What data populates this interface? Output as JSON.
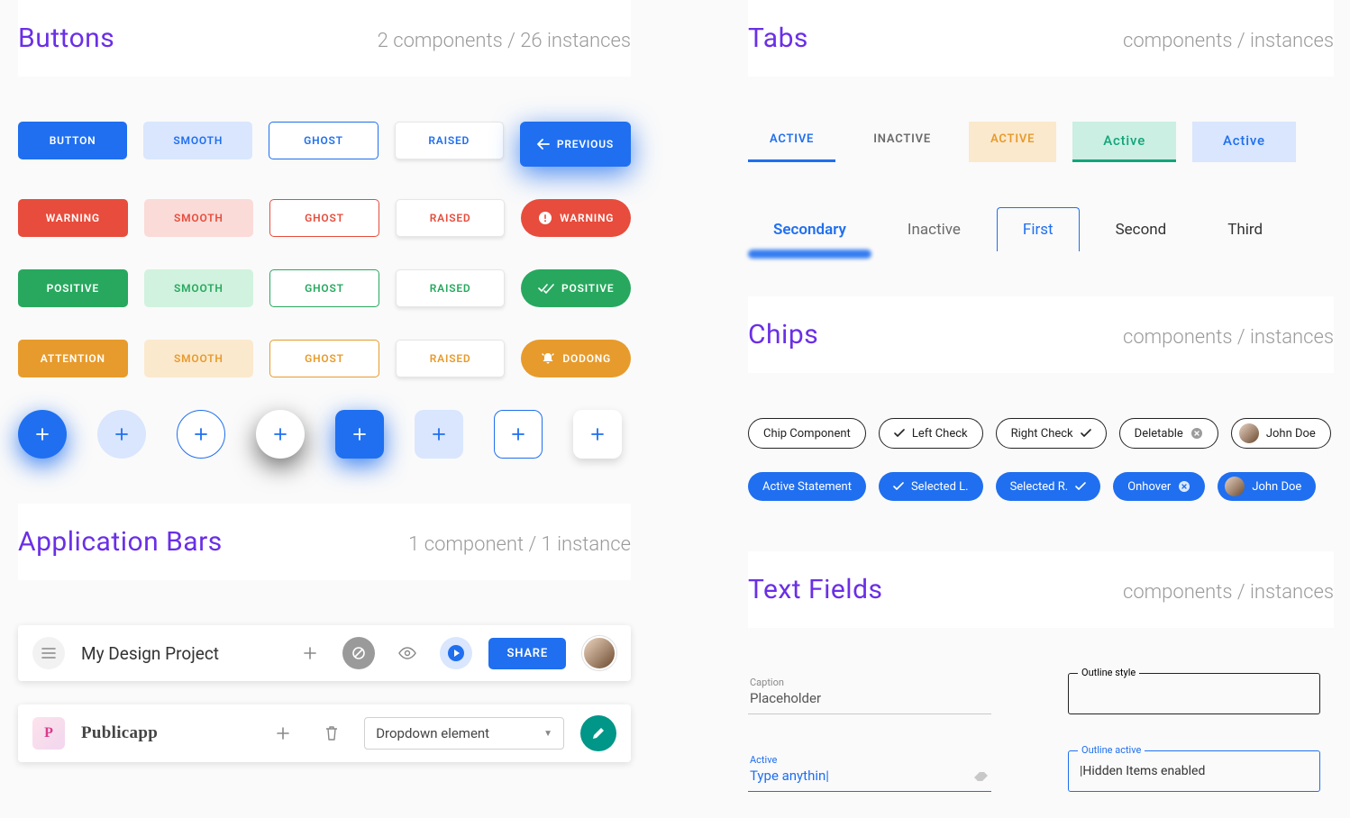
{
  "sections": {
    "buttons": {
      "title": "Buttons",
      "meta": "2 components  / 26 instances"
    },
    "appbars": {
      "title": "Application Bars",
      "meta": "1 component  / 1 instance"
    },
    "tabs": {
      "title": "Tabs",
      "meta": "components  / instances"
    },
    "chips": {
      "title": "Chips",
      "meta": "components  / instances"
    },
    "textfields": {
      "title": "Text Fields",
      "meta": "components  / instances"
    }
  },
  "buttons": {
    "primary": {
      "filled": "BUTTON",
      "smooth": "SMOOTH",
      "ghost": "GHOST",
      "raised": "RAISED",
      "special": "PREVIOUS"
    },
    "warning": {
      "filled": "WARNING",
      "smooth": "SMOOTH",
      "ghost": "GHOST",
      "raised": "RAISED",
      "special": "WARNING"
    },
    "positive": {
      "filled": "POSITIVE",
      "smooth": "SMOOTH",
      "ghost": "GHOST",
      "raised": "RAISED",
      "special": "POSITIVE"
    },
    "attention": {
      "filled": "ATTENTION",
      "smooth": "SMOOTH",
      "ghost": "GHOST",
      "raised": "RAISED",
      "special": "DODONG"
    }
  },
  "appbar1": {
    "title": "My Design Project",
    "share": "SHARE"
  },
  "appbar2": {
    "logo": "P",
    "title": "Publicapp",
    "dropdown": "Dropdown element"
  },
  "tabs1": {
    "active": "ACTIVE",
    "inactive": "INACTIVE",
    "yellow": "ACTIVE",
    "teal": "Active",
    "lightblue": "Active"
  },
  "tabs2": {
    "secondary": "Secondary",
    "inactive": "Inactive",
    "first": "First",
    "second": "Second",
    "third": "Third"
  },
  "chips_row1": {
    "component": "Chip Component",
    "leftcheck": "Left Check",
    "rightcheck": "Right Check",
    "deletable": "Deletable",
    "johndoe": "John Doe"
  },
  "chips_row2": {
    "activestmt": "Active Statement",
    "selectedl": "Selected L.",
    "selectedr": "Selected R.",
    "onhover": "Onhover",
    "johndoe": "John Doe"
  },
  "tf": {
    "caption_label": "Caption",
    "caption_ph": "Placeholder",
    "active_label": "Active",
    "active_val": "Type anythin|",
    "outline_label": "Outline style",
    "outline_active_label": "Outline active",
    "outline_active_val": "|Hidden Items enabled"
  }
}
